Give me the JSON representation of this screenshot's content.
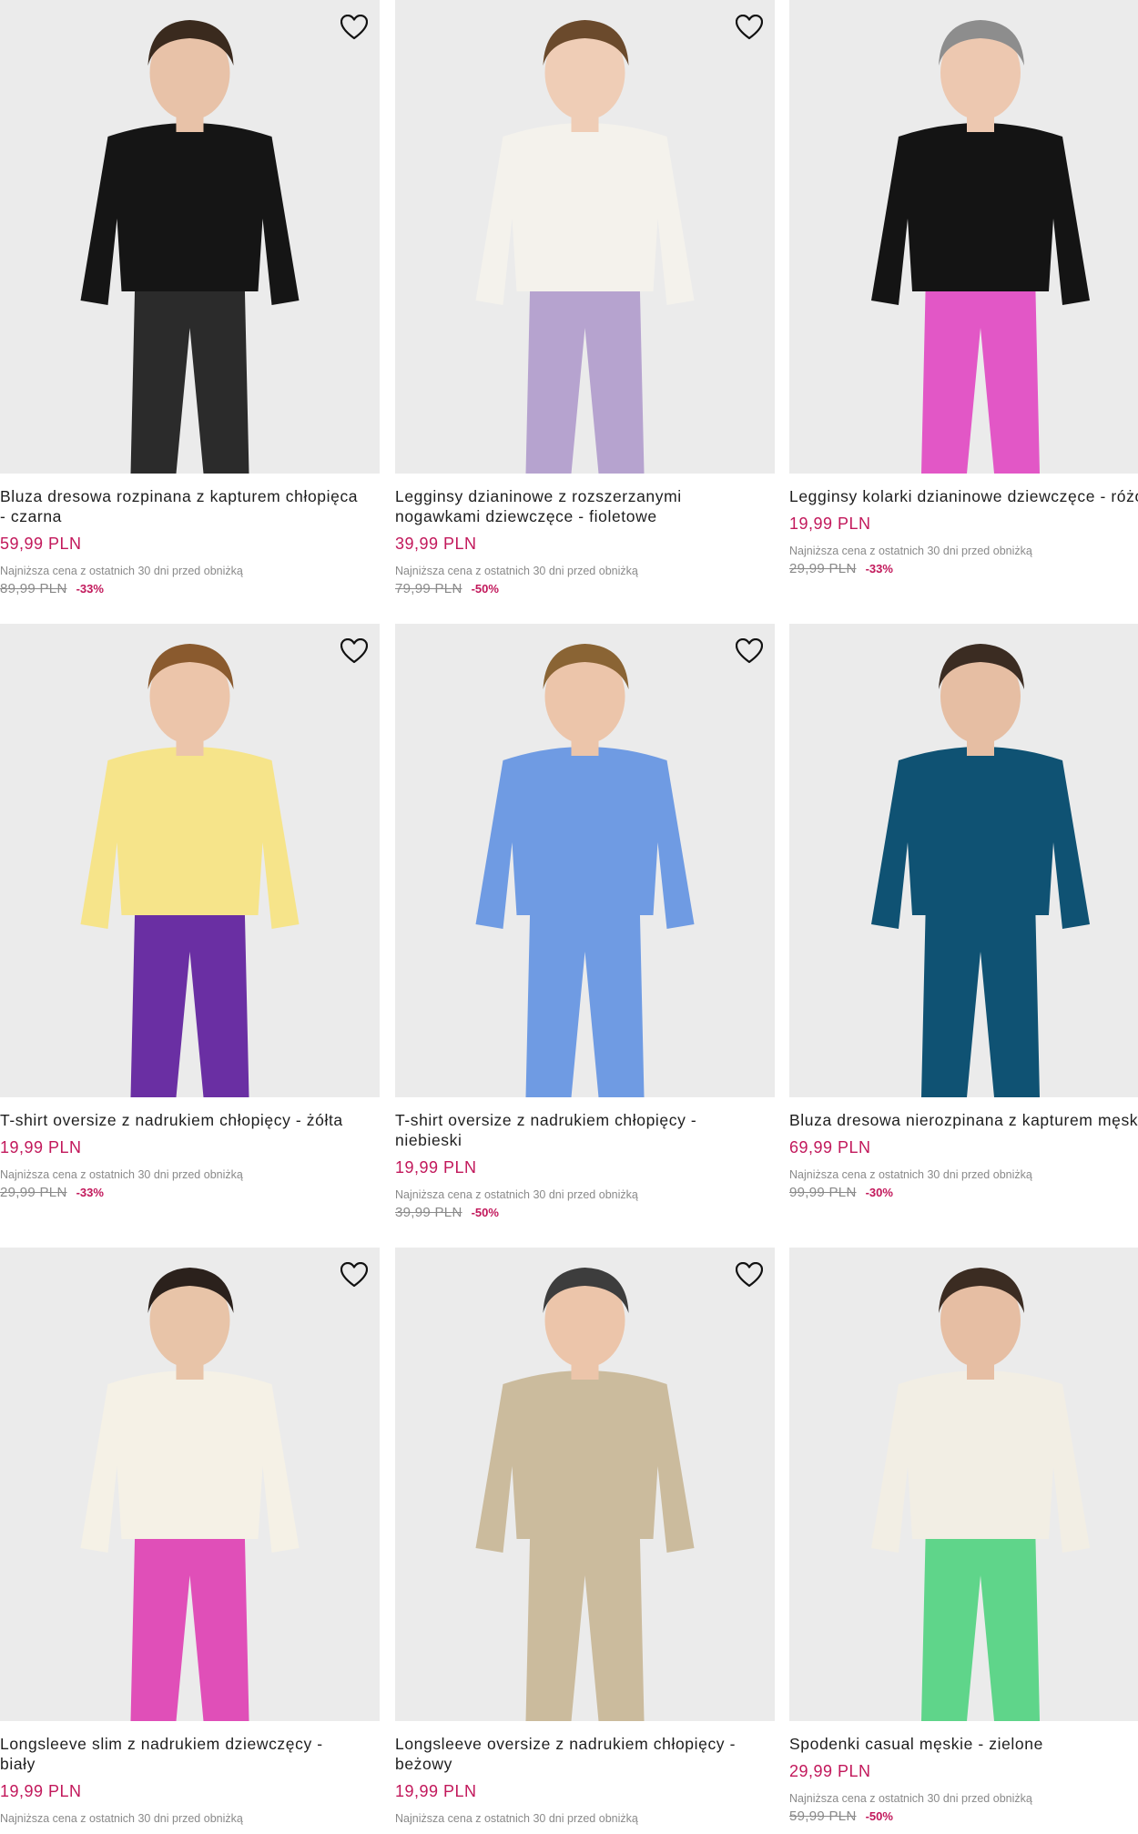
{
  "products": [
    {
      "title": "Bluza dresowa rozpinana z kapturem chłopięca\n- czarna",
      "price": "59,99 PLN",
      "lowest_label": "Najniższa cena z ostatnich 30 dni przed obniżką",
      "old_price": "89,99 PLN",
      "discount": "-33%",
      "wishlist_icon": "heart-outline-icon",
      "colors": {
        "top": "#151515",
        "bottom": "#2b2b2b",
        "skin": "#e8c2a8",
        "hair": "#3a2a1e"
      }
    },
    {
      "title": "Legginsy dzianinowe z rozszerzanymi\nnogawkami dziewczęce - fioletowe",
      "price": "39,99 PLN",
      "lowest_label": "Najniższa cena z ostatnich 30 dni przed obniżką",
      "old_price": "79,99 PLN",
      "discount": "-50%",
      "wishlist_icon": "heart-outline-icon",
      "colors": {
        "top": "#f4f2ec",
        "bottom": "#b6a3cf",
        "skin": "#efcdb6",
        "hair": "#6b4a2c"
      }
    },
    {
      "title": "Legginsy kolarki dzianinowe dziewczęce -\nróżowe",
      "price": "19,99 PLN",
      "lowest_label": "Najniższa cena z ostatnich 30 dni przed obniżką",
      "old_price": "29,99 PLN",
      "discount": "-33%",
      "wishlist_icon": "heart-outline-icon",
      "colors": {
        "top": "#141414",
        "bottom": "#e257c6",
        "skin": "#edc8b0",
        "hair": "#8d8d8d"
      }
    },
    {
      "title": "T-shirt oversize z nadrukiem chłopięcy - żółta",
      "price": "19,99 PLN",
      "lowest_label": "Najniższa cena z ostatnich 30 dni przed obniżką",
      "old_price": "29,99 PLN",
      "discount": "-33%",
      "wishlist_icon": "heart-outline-icon",
      "colors": {
        "top": "#f6e48a",
        "bottom": "#6a2fa3",
        "skin": "#ecc5aa",
        "hair": "#8a5a2e"
      }
    },
    {
      "title": "T-shirt oversize z nadrukiem chłopięcy -\nniebieski",
      "price": "19,99 PLN",
      "lowest_label": "Najniższa cena z ostatnich 30 dni przed obniżką",
      "old_price": "39,99 PLN",
      "discount": "-50%",
      "wishlist_icon": "heart-outline-icon",
      "colors": {
        "top": "#6f9be3",
        "bottom": "#6f9be3",
        "skin": "#ecc5aa",
        "hair": "#8a6434"
      }
    },
    {
      "title": "Bluza dresowa nierozpinana z kapturem męska\n- turkusowa",
      "price": "69,99 PLN",
      "lowest_label": "Najniższa cena z ostatnich 30 dni przed obniżką",
      "old_price": "99,99 PLN",
      "discount": "-30%",
      "wishlist_icon": "heart-outline-icon",
      "colors": {
        "top": "#0f5273",
        "bottom": "#0f5273",
        "skin": "#e6bea3",
        "hair": "#3b2c22"
      }
    },
    {
      "title": "Longsleeve slim z nadrukiem dziewczęcy -\nbiały",
      "price": "19,99 PLN",
      "lowest_label": "Najniższa cena z ostatnich 30 dni przed obniżką",
      "old_price": "",
      "discount": "",
      "wishlist_icon": "heart-outline-icon",
      "colors": {
        "top": "#f5f1e6",
        "bottom": "#e04fb8",
        "skin": "#e8c4a8",
        "hair": "#2b211c"
      }
    },
    {
      "title": "Longsleeve oversize z nadrukiem chłopięcy -\nbeżowy",
      "price": "19,99 PLN",
      "lowest_label": "Najniższa cena z ostatnich 30 dni przed obniżką",
      "old_price": "",
      "discount": "",
      "wishlist_icon": "heart-outline-icon",
      "colors": {
        "top": "#cbbb9d",
        "bottom": "#cbbb9d",
        "skin": "#ecc5aa",
        "hair": "#3d3d3d"
      }
    },
    {
      "title": "Spodenki casual męskie - zielone",
      "price": "29,99 PLN",
      "lowest_label": "Najniższa cena z ostatnich 30 dni przed obniżką",
      "old_price": "59,99 PLN",
      "discount": "-50%",
      "wishlist_icon": "heart-outline-icon",
      "colors": {
        "top": "#f2eee4",
        "bottom": "#5fd58a",
        "skin": "#e6bea3",
        "hair": "#3b2c22"
      }
    }
  ]
}
